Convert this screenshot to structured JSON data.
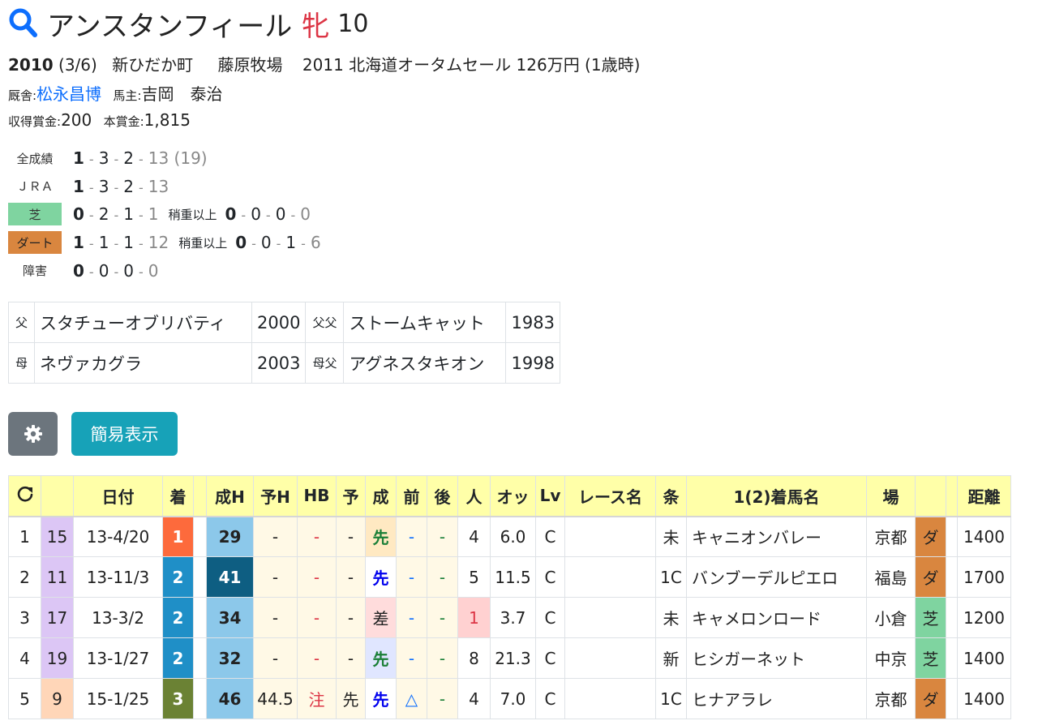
{
  "horse": {
    "name": "アンスタンフィール",
    "sex": "牝",
    "age": "10"
  },
  "info": {
    "birth_year": "2010",
    "birth_date": "(3/6)",
    "region": "新ひだか町",
    "breeder": "藤原牧場",
    "sale": "2011 北海道オータムセール 126万円 (1歳時)",
    "trainer_label": "厩舎:",
    "trainer": "松永昌博",
    "owner_label": "馬主:",
    "owner": "吉岡　泰治",
    "earned_label": "収得賞金:",
    "earned": "200",
    "prize_label": "本賞金:",
    "prize": "1,815"
  },
  "records": [
    {
      "label": "全成績",
      "a": "1",
      "b": "3",
      "c": "2",
      "d": "13",
      "extra": "(19)"
    },
    {
      "label": "ＪＲＡ",
      "a": "1",
      "b": "3",
      "c": "2",
      "d": "13"
    },
    {
      "label": "芝",
      "a": "0",
      "b": "2",
      "c": "1",
      "d": "1",
      "sub_label": "稍重以上",
      "sa": "0",
      "sb": "0",
      "sc": "0",
      "sd": "0"
    },
    {
      "label": "ダート",
      "a": "1",
      "b": "1",
      "c": "1",
      "d": "12",
      "sub_label": "稍重以上",
      "sa": "0",
      "sb": "0",
      "sc": "1",
      "sd": "6"
    },
    {
      "label": "障害",
      "a": "0",
      "b": "0",
      "c": "0",
      "d": "0"
    }
  ],
  "pedigree": {
    "sire_tag": "父",
    "sire": "スタチューオブリバティ",
    "sire_year": "2000",
    "sire_sire_tag": "父父",
    "sire_sire": "ストームキャット",
    "sire_sire_year": "1983",
    "dam_tag": "母",
    "dam": "ネヴァカグラ",
    "dam_year": "2003",
    "dam_sire_tag": "母父",
    "dam_sire": "アグネスタキオン",
    "dam_sire_year": "1998"
  },
  "buttons": {
    "settings_icon": "gear-icon",
    "simple_view": "簡易表示"
  },
  "table": {
    "headers": [
      "",
      "",
      "日付",
      "着",
      "",
      "成H",
      "予H",
      "HB",
      "予",
      "成",
      "前",
      "後",
      "人",
      "オッ",
      "Lv",
      "レース名",
      "条",
      "1(2)着馬名",
      "場",
      "",
      "",
      "距離"
    ],
    "refresh_icon": "refresh-icon",
    "rows": [
      {
        "no": "1",
        "waku": "15",
        "date": "13-4/20",
        "rank": "1",
        "h": "29",
        "yh": "-",
        "hb": "-",
        "yo": "-",
        "sei": "先",
        "mae": "-",
        "ato": "-",
        "ninki": "4",
        "odds": "6.0",
        "lv": "C",
        "race": "",
        "jou": "未",
        "horse": "キャニオンバレー",
        "ba": "京都",
        "surf": "ダ",
        "dist": "1400"
      },
      {
        "no": "2",
        "waku": "11",
        "date": "13-11/3",
        "rank": "2",
        "h": "41",
        "yh": "-",
        "hb": "-",
        "yo": "-",
        "sei": "先",
        "mae": "-",
        "ato": "-",
        "ninki": "5",
        "odds": "11.5",
        "lv": "C",
        "race": "",
        "jou": "1C",
        "horse": "バンブーデルピエロ",
        "ba": "福島",
        "surf": "ダ",
        "dist": "1700"
      },
      {
        "no": "3",
        "waku": "17",
        "date": "13-3/2",
        "rank": "2",
        "h": "34",
        "yh": "-",
        "hb": "-",
        "yo": "-",
        "sei": "差",
        "mae": "-",
        "ato": "-",
        "ninki": "1",
        "odds": "3.7",
        "lv": "C",
        "race": "",
        "jou": "未",
        "horse": "キャメロンロード",
        "ba": "小倉",
        "surf": "芝",
        "dist": "1200"
      },
      {
        "no": "4",
        "waku": "19",
        "date": "13-1/27",
        "rank": "2",
        "h": "32",
        "yh": "-",
        "hb": "-",
        "yo": "-",
        "sei": "先",
        "mae": "-",
        "ato": "-",
        "ninki": "8",
        "odds": "21.3",
        "lv": "C",
        "race": "",
        "jou": "新",
        "horse": "ヒシガーネット",
        "ba": "中京",
        "surf": "芝",
        "dist": "1400"
      },
      {
        "no": "5",
        "waku": "9",
        "date": "15-1/25",
        "rank": "3",
        "h": "46",
        "yh": "44.5",
        "hb": "注",
        "yo": "先",
        "sei": "先",
        "mae": "△",
        "ato": "-",
        "ninki": "4",
        "odds": "7.0",
        "lv": "C",
        "race": "",
        "jou": "1C",
        "horse": "ヒナアラレ",
        "ba": "京都",
        "surf": "ダ",
        "dist": "1400"
      }
    ]
  },
  "colors": {
    "accent_blue": "#0d6efd",
    "sex_red": "#dc3545",
    "header_yellow": "#ffffa8",
    "turf_green": "#7fd4a0",
    "dirt_orange": "#d9863f"
  }
}
